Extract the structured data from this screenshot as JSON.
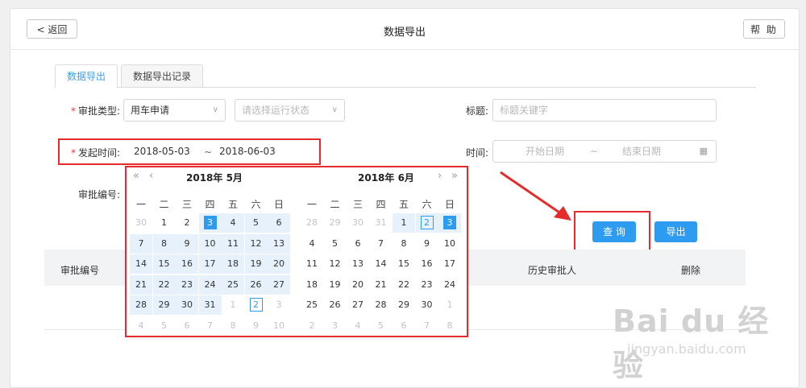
{
  "header": {
    "back_label": "< 返回",
    "title": "数据导出",
    "help_label": "帮 助"
  },
  "tabs": [
    {
      "label": "数据导出",
      "active": true
    },
    {
      "label": "数据导出记录",
      "active": false
    }
  ],
  "form": {
    "approval_type_label": "审批类型:",
    "approval_type_value": "用车申请",
    "status_placeholder": "请选择运行状态",
    "title_label": "标题:",
    "title_placeholder": "标题关键字",
    "start_time_label": "发起时间:",
    "start_date": "2018-05-03",
    "range_sep": "~",
    "end_date": "2018-06-03",
    "time_label": "时间:",
    "time_start_placeholder": "开始日期",
    "time_end_placeholder": "结束日期",
    "approval_no_label": "审批编号:"
  },
  "buttons": {
    "query_label": "查 询",
    "export_label": "导出"
  },
  "table": {
    "headers": [
      "审批编号",
      "历史审批人",
      "删除"
    ]
  },
  "calendar": {
    "weekdays": [
      "一",
      "二",
      "三",
      "四",
      "五",
      "六",
      "日"
    ],
    "left": {
      "title": "2018年 5月",
      "rows": [
        [
          "30",
          "1",
          "2",
          "3",
          "4",
          "5",
          "6"
        ],
        [
          "7",
          "8",
          "9",
          "10",
          "11",
          "12",
          "13"
        ],
        [
          "14",
          "15",
          "16",
          "17",
          "18",
          "19",
          "20"
        ],
        [
          "21",
          "22",
          "23",
          "24",
          "25",
          "26",
          "27"
        ],
        [
          "28",
          "29",
          "30",
          "31",
          "1",
          "2",
          "3"
        ],
        [
          "4",
          "5",
          "6",
          "7",
          "8",
          "9",
          "10"
        ]
      ]
    },
    "right": {
      "title": "2018年 6月",
      "rows": [
        [
          "28",
          "29",
          "30",
          "31",
          "1",
          "2",
          "3"
        ],
        [
          "4",
          "5",
          "6",
          "7",
          "8",
          "9",
          "10"
        ],
        [
          "11",
          "12",
          "13",
          "14",
          "15",
          "16",
          "17"
        ],
        [
          "18",
          "19",
          "20",
          "21",
          "22",
          "23",
          "24"
        ],
        [
          "25",
          "26",
          "27",
          "28",
          "29",
          "30",
          "1"
        ],
        [
          "2",
          "3",
          "4",
          "5",
          "6",
          "7",
          "8"
        ]
      ]
    },
    "nav": {
      "prev_year": "«",
      "prev_month": "‹",
      "next_month": "›",
      "next_year": "»"
    }
  },
  "icons": {
    "calendar": "calendar-icon",
    "chevron": "chevron-down-icon"
  },
  "colors": {
    "accent": "#2d9cf0",
    "annotation": "#e52b2b"
  },
  "watermark": {
    "text": "Bai du 经验",
    "url": "jingyan.baidu.com"
  }
}
